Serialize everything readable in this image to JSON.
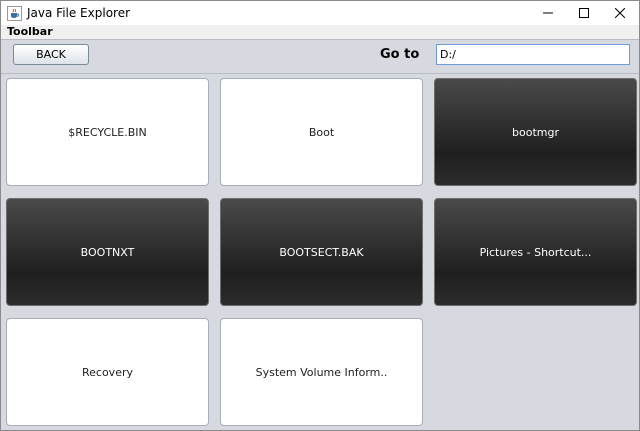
{
  "window": {
    "title": "Java File Explorer"
  },
  "toolbar": {
    "label": "Toolbar",
    "back_label": "BACK",
    "goto_label": "Go to",
    "path_value": "D:/"
  },
  "items": [
    {
      "name": "$RECYCLE.BIN",
      "kind": "folder"
    },
    {
      "name": "Boot",
      "kind": "folder"
    },
    {
      "name": "bootmgr",
      "kind": "file"
    },
    {
      "name": "BOOTNXT",
      "kind": "file"
    },
    {
      "name": "BOOTSECT.BAK",
      "kind": "file"
    },
    {
      "name": "Pictures - Shortcut...",
      "kind": "file"
    },
    {
      "name": "Recovery",
      "kind": "folder"
    },
    {
      "name": "System Volume Inform..",
      "kind": "folder"
    }
  ],
  "icons": {
    "app": "java-cup-icon",
    "minimize": "minimize-icon",
    "maximize": "maximize-icon",
    "close": "close-icon"
  }
}
